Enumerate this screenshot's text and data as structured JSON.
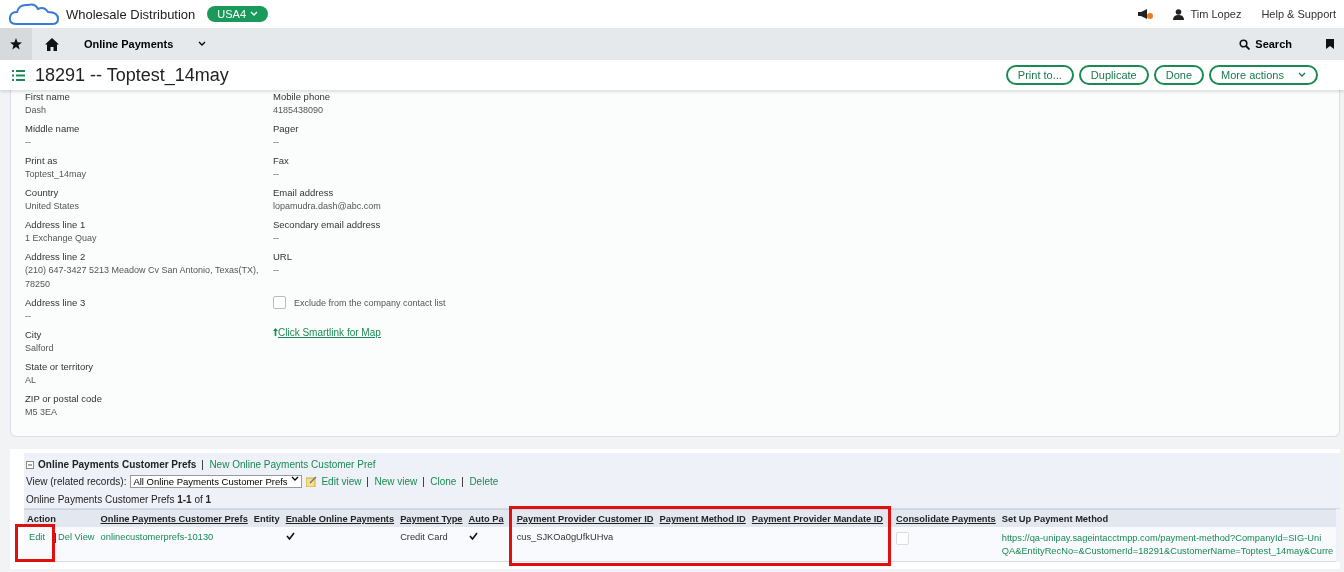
{
  "topbar": {
    "company": "Wholesale Distribution",
    "entity": "USA4",
    "user": "Tim Lopez",
    "help": "Help & Support"
  },
  "nav": {
    "module": "Online Payments",
    "search": "Search"
  },
  "header": {
    "title": "18291 -- Toptest_14may",
    "buttons": [
      {
        "label": "Print to...",
        "kind": "plain"
      },
      {
        "label": "Duplicate",
        "kind": "plain"
      },
      {
        "label": "Done",
        "kind": "plain"
      },
      {
        "label": "More actions",
        "kind": "menu"
      }
    ]
  },
  "fields_left": [
    {
      "label": "First name",
      "value": "Dash"
    },
    {
      "label": "Middle name",
      "value": "--"
    },
    {
      "label": "Print as",
      "value": "Toptest_14may"
    },
    {
      "label": "Country",
      "value": "United States"
    },
    {
      "label": "Address line 1",
      "value": "1 Exchange Quay"
    },
    {
      "label": "Address line 2",
      "value": "(210) 647-3427 5213 Meadow Cv San Antonio, Texas(TX), 78250"
    },
    {
      "label": "Address line 3",
      "value": "--"
    },
    {
      "label": "City",
      "value": "Salford"
    },
    {
      "label": "State or territory",
      "value": "AL"
    },
    {
      "label": "ZIP or postal code",
      "value": "M5 3EA"
    }
  ],
  "fields_right": [
    {
      "label": "Mobile phone",
      "value": "4185438090"
    },
    {
      "label": "Pager",
      "value": "--"
    },
    {
      "label": "Fax",
      "value": "--"
    },
    {
      "label": "Email address",
      "value": "lopamudra.dash@abc.com"
    },
    {
      "label": "Secondary email address",
      "value": "--"
    },
    {
      "label": "URL",
      "value": "--"
    }
  ],
  "exclude_checkbox": {
    "label": "Exclude from the company contact list",
    "checked": false
  },
  "map_link": "Click Smartlink for Map",
  "related": {
    "title": "Online Payments Customer Prefs",
    "new_link": "New Online Payments Customer Pref",
    "view_label": "View (related records):",
    "view_value": "All Online Payments Customer Prefs",
    "view_links": [
      "Edit view",
      "New view",
      "Clone",
      "Delete"
    ],
    "count_label": "Online Payments Customer Prefs",
    "count_range": "1-1",
    "count_of": "of",
    "count_total": "1",
    "columns": [
      {
        "label": "Action",
        "sortable": false,
        "highlighted": false
      },
      {
        "label": "Online Payments Customer Prefs",
        "sortable": true,
        "highlighted": false
      },
      {
        "label": "Entity",
        "sortable": false,
        "highlighted": false
      },
      {
        "label": "Enable Online Payments",
        "sortable": true,
        "highlighted": false
      },
      {
        "label": "Payment Type",
        "sortable": true,
        "highlighted": false
      },
      {
        "label": "Auto Pa",
        "sortable": true,
        "highlighted": false
      },
      {
        "label": "Payment Provider Customer ID",
        "sortable": true,
        "highlighted": true
      },
      {
        "label": "Payment Method ID",
        "sortable": true,
        "highlighted": true
      },
      {
        "label": "Payment Provider Mandate ID",
        "sortable": true,
        "highlighted": true
      },
      {
        "label": "Consolidate Payments",
        "sortable": true,
        "highlighted": false
      },
      {
        "label": "Set Up Payment Method",
        "sortable": false,
        "highlighted": false
      }
    ],
    "rows": [
      {
        "edit": "Edit",
        "edit_highlighted": true,
        "del_view": "Del View",
        "name": "onlinecustomerprefs-10130",
        "enable_online": true,
        "payment_type": "Credit Card",
        "auto_pay": true,
        "provider_customer_id": "cus_SJKOa0gUfkUHva",
        "consolidate": false,
        "setup_url": [
          "https://qa-unipay.sageintacctmpp.com/payment-method?CompanyId=SIG-Uni",
          "QA&EntityRecNo=&CustomerId=18291&CustomerName=Toptest_14may&Curre"
        ]
      }
    ]
  }
}
